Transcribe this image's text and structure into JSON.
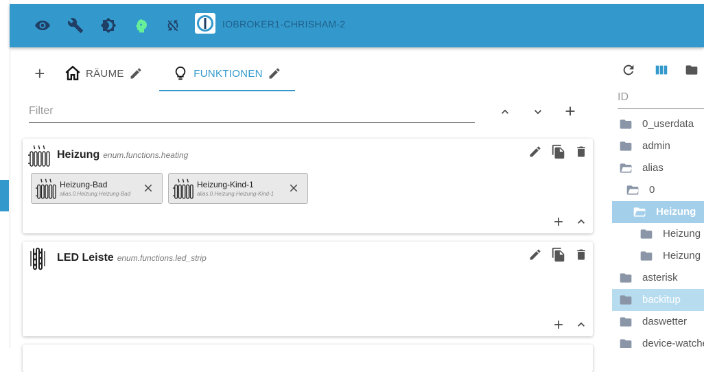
{
  "header": {
    "hostname": "IOBROKER1-CHRISHAM-2",
    "icons": [
      "eye-icon",
      "wrench-icon",
      "brightness-icon",
      "expert-mode-icon",
      "sync-disabled-icon"
    ]
  },
  "tabs": {
    "add_label": "+",
    "rooms_label": "RÄUME",
    "functions_label": "FUNKTIONEN"
  },
  "filter": {
    "placeholder": "Filter",
    "value": ""
  },
  "cards": [
    {
      "title": "Heizung",
      "id": "enum.functions.heating",
      "members": [
        {
          "name": "Heizung-Bad",
          "id": "alias.0.Heizung.Heizung-Bad"
        },
        {
          "name": "Heizung-Kind-1",
          "id": "alias.0.Heizung.Heizung-Kind-1"
        }
      ]
    },
    {
      "title": "LED Leiste",
      "id": "enum.functions.led_strip",
      "members": []
    }
  ],
  "tree": {
    "header": "ID",
    "items": [
      {
        "label": "0_userdata",
        "level": 0,
        "open": false,
        "selected": false
      },
      {
        "label": "admin",
        "level": 0,
        "open": false,
        "selected": false
      },
      {
        "label": "alias",
        "level": 0,
        "open": true,
        "selected": false
      },
      {
        "label": "0",
        "level": 1,
        "open": true,
        "selected": false
      },
      {
        "label": "Heizung",
        "level": 2,
        "open": true,
        "selected": true
      },
      {
        "label": "Heizung",
        "level": 3,
        "open": false,
        "selected": false
      },
      {
        "label": "Heizung",
        "level": 3,
        "open": false,
        "selected": false
      },
      {
        "label": "asterisk",
        "level": 0,
        "open": false,
        "selected": false
      },
      {
        "label": "backitup",
        "level": 0,
        "open": false,
        "selected": "hover"
      },
      {
        "label": "daswetter",
        "level": 0,
        "open": false,
        "selected": false
      },
      {
        "label": "device-watcher",
        "level": 0,
        "open": false,
        "selected": false
      }
    ]
  },
  "colors": {
    "primary": "#3399cc",
    "selected_row": "#a3cfea",
    "hover_row": "#b7dcef",
    "folder": "#8a96a8",
    "expert_icon": "#66ee99"
  }
}
